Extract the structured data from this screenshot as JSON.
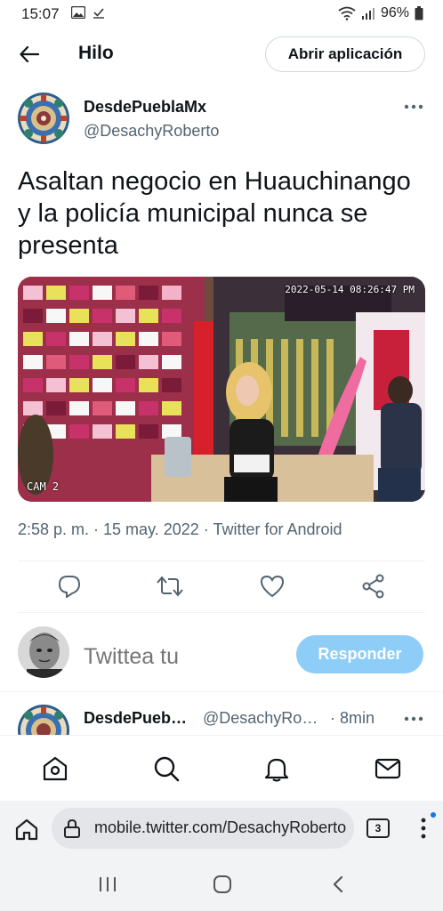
{
  "status_bar": {
    "time": "15:07",
    "battery": "96%"
  },
  "header": {
    "title": "Hilo",
    "open_app_label": "Abrir aplicación"
  },
  "tweet": {
    "author_name": "DesdePueblaMx",
    "author_handle": "@DesachyRoberto",
    "text": "Asaltan negocio en Huauchinango y la policía municipal nunca se presenta",
    "media": {
      "timestamp_overlay": "2022-05-14 08:26:47 PM",
      "camera_label": "CAM 2"
    },
    "meta": "2:58 p. m. · 15 may. 2022 · Twitter for Android"
  },
  "actions": [
    "reply-icon",
    "retweet-icon",
    "like-icon",
    "share-icon"
  ],
  "reply_composer": {
    "placeholder": "Twittea tu",
    "button_label": "Responder"
  },
  "next_tweet": {
    "author_name": "DesdePueb…",
    "author_handle": "@DesachyRo…",
    "time": "· 8min"
  },
  "bottom_nav": [
    "home-icon",
    "explore-icon",
    "notifications-icon",
    "messages-icon"
  ],
  "browser": {
    "url": "mobile.twitter.com/DesachyRoberto",
    "tab_count": "3"
  },
  "colors": {
    "accent": "#1d9bf0",
    "reply_button_disabled": "#8ecdf8",
    "secondary_text": "#536471"
  }
}
